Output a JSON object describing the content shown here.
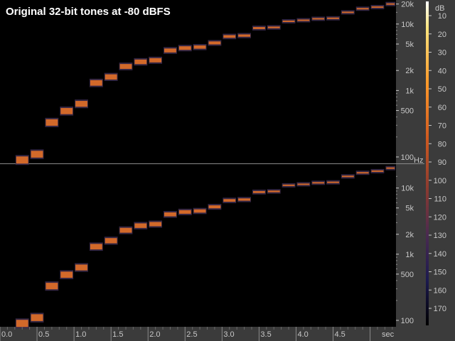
{
  "title": "Original 32-bit tones at -80 dBFS",
  "chart_data": {
    "type": "spectrogram",
    "title": "Original 32-bit tones at -80 dBFS",
    "x_axis": {
      "unit": "sec",
      "range": [
        0.0,
        5.35
      ],
      "ticks": [
        "0.0",
        "0.5",
        "1.0",
        "1.5",
        "2.0",
        "2.5",
        "3.0",
        "3.5",
        "4.0",
        "4.5"
      ]
    },
    "y_axis": {
      "scale": "log",
      "unit": "Hz",
      "range": [
        80,
        23000
      ],
      "ticks": [
        "100",
        "500",
        "1k",
        "2k",
        "5k",
        "10k",
        "20k"
      ],
      "ticks_lower": [
        "100",
        "500",
        "1k",
        "2k",
        "5k",
        "10k"
      ]
    },
    "colorbar": {
      "unit": "dB",
      "ticks": [
        "10",
        "20",
        "30",
        "40",
        "50",
        "60",
        "70",
        "80",
        "90",
        "100",
        "110",
        "120",
        "130",
        "140",
        "150",
        "160",
        "170"
      ]
    },
    "series": [
      {
        "panel": "top",
        "tones": [
          {
            "t_start": 0.2,
            "t_end": 0.4,
            "freq_hz": 90
          },
          {
            "t_start": 0.4,
            "t_end": 0.6,
            "freq_hz": 110
          },
          {
            "t_start": 0.6,
            "t_end": 0.8,
            "freq_hz": 330
          },
          {
            "t_start": 0.8,
            "t_end": 1.0,
            "freq_hz": 490
          },
          {
            "t_start": 1.0,
            "t_end": 1.2,
            "freq_hz": 630
          },
          {
            "t_start": 1.2,
            "t_end": 1.4,
            "freq_hz": 1300
          },
          {
            "t_start": 1.4,
            "t_end": 1.6,
            "freq_hz": 1600
          },
          {
            "t_start": 1.6,
            "t_end": 1.8,
            "freq_hz": 2300
          },
          {
            "t_start": 1.8,
            "t_end": 2.0,
            "freq_hz": 2700
          },
          {
            "t_start": 2.0,
            "t_end": 2.2,
            "freq_hz": 2850
          },
          {
            "t_start": 2.2,
            "t_end": 2.4,
            "freq_hz": 4000
          },
          {
            "t_start": 2.4,
            "t_end": 2.6,
            "freq_hz": 4350
          },
          {
            "t_start": 2.6,
            "t_end": 2.8,
            "freq_hz": 4500
          },
          {
            "t_start": 2.8,
            "t_end": 3.0,
            "freq_hz": 5200
          },
          {
            "t_start": 3.0,
            "t_end": 3.2,
            "freq_hz": 6500
          },
          {
            "t_start": 3.2,
            "t_end": 3.4,
            "freq_hz": 6700
          },
          {
            "t_start": 3.4,
            "t_end": 3.6,
            "freq_hz": 8700
          },
          {
            "t_start": 3.6,
            "t_end": 3.8,
            "freq_hz": 8900
          },
          {
            "t_start": 3.8,
            "t_end": 4.0,
            "freq_hz": 11000
          },
          {
            "t_start": 4.0,
            "t_end": 4.2,
            "freq_hz": 11400
          },
          {
            "t_start": 4.2,
            "t_end": 4.4,
            "freq_hz": 12000
          },
          {
            "t_start": 4.4,
            "t_end": 4.6,
            "freq_hz": 12200
          },
          {
            "t_start": 4.6,
            "t_end": 4.8,
            "freq_hz": 15000
          },
          {
            "t_start": 4.8,
            "t_end": 5.0,
            "freq_hz": 17000
          },
          {
            "t_start": 5.0,
            "t_end": 5.2,
            "freq_hz": 18000
          },
          {
            "t_start": 5.2,
            "t_end": 5.35,
            "freq_hz": 20000
          }
        ]
      },
      {
        "panel": "bottom",
        "tones": [
          {
            "t_start": 0.2,
            "t_end": 0.4,
            "freq_hz": 90
          },
          {
            "t_start": 0.4,
            "t_end": 0.6,
            "freq_hz": 110
          },
          {
            "t_start": 0.6,
            "t_end": 0.8,
            "freq_hz": 330
          },
          {
            "t_start": 0.8,
            "t_end": 1.0,
            "freq_hz": 490
          },
          {
            "t_start": 1.0,
            "t_end": 1.2,
            "freq_hz": 630
          },
          {
            "t_start": 1.2,
            "t_end": 1.4,
            "freq_hz": 1300
          },
          {
            "t_start": 1.4,
            "t_end": 1.6,
            "freq_hz": 1600
          },
          {
            "t_start": 1.6,
            "t_end": 1.8,
            "freq_hz": 2300
          },
          {
            "t_start": 1.8,
            "t_end": 2.0,
            "freq_hz": 2700
          },
          {
            "t_start": 2.0,
            "t_end": 2.2,
            "freq_hz": 2850
          },
          {
            "t_start": 2.2,
            "t_end": 2.4,
            "freq_hz": 4000
          },
          {
            "t_start": 2.4,
            "t_end": 2.6,
            "freq_hz": 4350
          },
          {
            "t_start": 2.6,
            "t_end": 2.8,
            "freq_hz": 4500
          },
          {
            "t_start": 2.8,
            "t_end": 3.0,
            "freq_hz": 5200
          },
          {
            "t_start": 3.0,
            "t_end": 3.2,
            "freq_hz": 6500
          },
          {
            "t_start": 3.2,
            "t_end": 3.4,
            "freq_hz": 6700
          },
          {
            "t_start": 3.4,
            "t_end": 3.6,
            "freq_hz": 8700
          },
          {
            "t_start": 3.6,
            "t_end": 3.8,
            "freq_hz": 8900
          },
          {
            "t_start": 3.8,
            "t_end": 4.0,
            "freq_hz": 11000
          },
          {
            "t_start": 4.0,
            "t_end": 4.2,
            "freq_hz": 11400
          },
          {
            "t_start": 4.2,
            "t_end": 4.4,
            "freq_hz": 12000
          },
          {
            "t_start": 4.4,
            "t_end": 4.6,
            "freq_hz": 12200
          },
          {
            "t_start": 4.6,
            "t_end": 4.8,
            "freq_hz": 15000
          },
          {
            "t_start": 4.8,
            "t_end": 5.0,
            "freq_hz": 17000
          },
          {
            "t_start": 5.0,
            "t_end": 5.2,
            "freq_hz": 18000
          },
          {
            "t_start": 5.2,
            "t_end": 5.35,
            "freq_hz": 20000
          }
        ]
      }
    ],
    "colors": {
      "background": "#000000",
      "tone": "#d2692a",
      "tone_glow": "#3a2a4a",
      "axis_panel": "#3b3b3b",
      "axis_text": "#c8c8c8"
    },
    "colormap": [
      "#ffffff",
      "#ffe680",
      "#ff9a2a",
      "#d05a20",
      "#8a3a30",
      "#4a2a50",
      "#1c1a50",
      "#000000"
    ],
    "unit_label_hz": "Hz"
  }
}
